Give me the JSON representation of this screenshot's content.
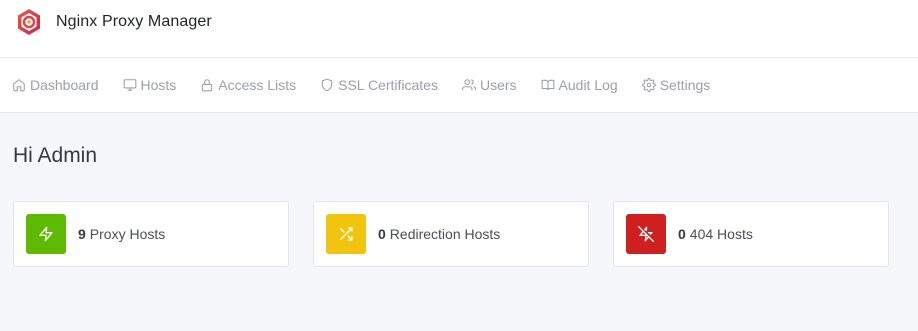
{
  "header": {
    "app_name": "Nginx Proxy Manager",
    "logo_icon": "nginx-proxy-manager-logo"
  },
  "nav": {
    "items": [
      {
        "label": "Dashboard",
        "icon": "home-icon"
      },
      {
        "label": "Hosts",
        "icon": "monitor-icon"
      },
      {
        "label": "Access Lists",
        "icon": "lock-icon"
      },
      {
        "label": "SSL Certificates",
        "icon": "shield-icon"
      },
      {
        "label": "Users",
        "icon": "users-icon"
      },
      {
        "label": "Audit Log",
        "icon": "book-icon"
      },
      {
        "label": "Settings",
        "icon": "gear-icon"
      }
    ]
  },
  "main": {
    "greeting": "Hi Admin",
    "cards": [
      {
        "count": "9",
        "label": "Proxy Hosts",
        "icon": "zap-icon",
        "color": "#5eba00"
      },
      {
        "count": "0",
        "label": "Redirection Hosts",
        "icon": "shuffle-icon",
        "color": "#f1c40f"
      },
      {
        "count": "0",
        "label": "404 Hosts",
        "icon": "zap-off-icon",
        "color": "#cd201f"
      }
    ]
  }
}
